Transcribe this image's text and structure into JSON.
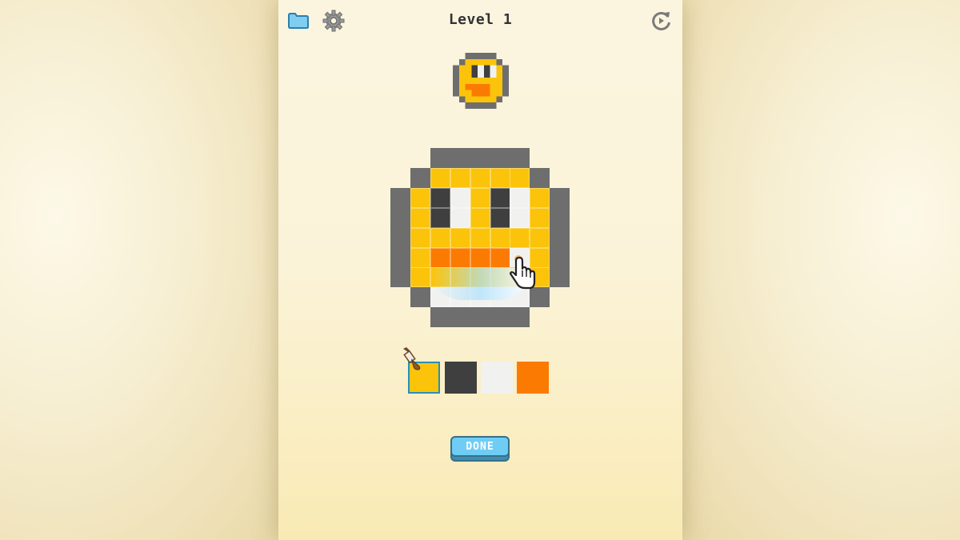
{
  "header": {
    "title": "Level 1",
    "icons": [
      "folder-icon",
      "gear-icon",
      "restart-icon"
    ]
  },
  "colors": {
    "yellow": "#fbc40a",
    "dark": "#3f3f3f",
    "white": "#f1f1ef",
    "orange": "#fb7b02",
    "outline": "#6e6e6e",
    "accent": "#6fcdf5"
  },
  "palette": {
    "swatches": [
      "#fbc40a",
      "#3f3f3f",
      "#f1f1ef",
      "#fb7b02"
    ],
    "selected_index": 0
  },
  "done_button": {
    "label": "DONE"
  }
}
